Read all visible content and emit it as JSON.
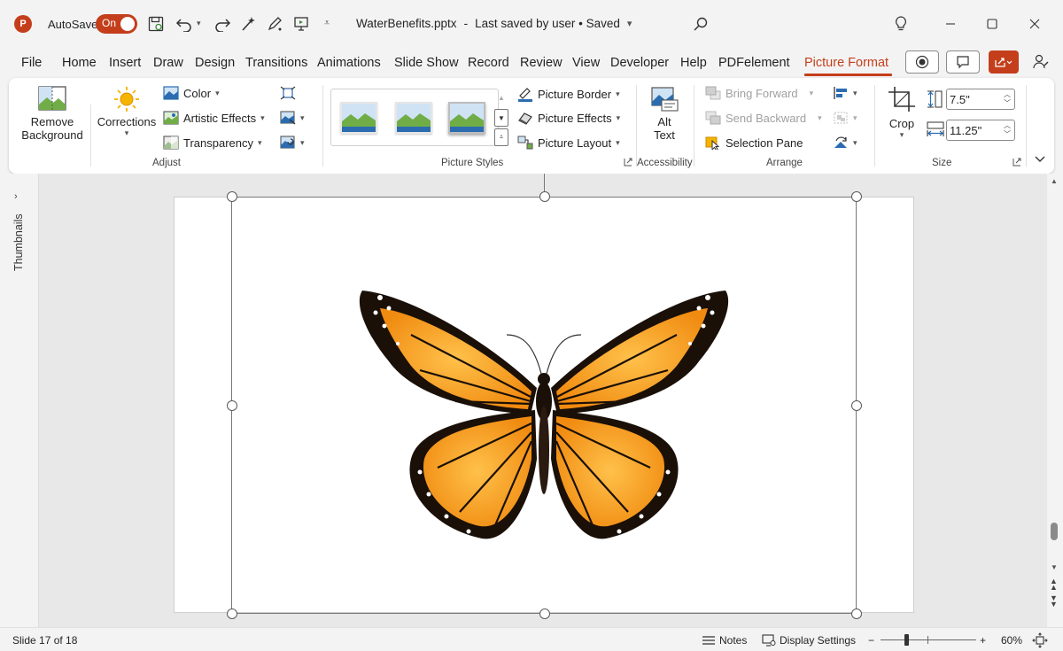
{
  "colors": {
    "accent": "#c43e1c",
    "toggle": "#c43e1c",
    "share": "#c43e1c"
  },
  "titlebar": {
    "app_icon": "powerpoint-logo",
    "autosave_label": "AutoSave",
    "autosave_state": "On",
    "filename": "WaterBenefits.pptx",
    "separator": "-",
    "save_status": "Last saved by user • Saved"
  },
  "menu": {
    "tabs": [
      "File",
      "Home",
      "Insert",
      "Draw",
      "Design",
      "Transitions",
      "Animations",
      "Slide Show",
      "Record",
      "Review",
      "View",
      "Developer",
      "Help",
      "PDFelement",
      "Picture Format"
    ],
    "active": "Picture Format"
  },
  "ribbon": {
    "adjust": {
      "remove_bg": [
        "Remove",
        "Background"
      ],
      "corrections": "Corrections",
      "color": "Color",
      "artistic": "Artistic Effects",
      "transparency": "Transparency",
      "group": "Adjust"
    },
    "styles": {
      "border": "Picture Border",
      "effects": "Picture Effects",
      "layout": "Picture Layout",
      "group": "Picture Styles"
    },
    "accessibility": {
      "alt": [
        "Alt",
        "Text"
      ],
      "group": "Accessibility"
    },
    "arrange": {
      "forward": "Bring Forward",
      "backward": "Send Backward",
      "selection": "Selection Pane",
      "group": "Arrange"
    },
    "size": {
      "crop": "Crop",
      "height": "7.5\"",
      "width": "11.25\"",
      "group": "Size"
    }
  },
  "left_panel": {
    "label": "Thumbnails"
  },
  "status": {
    "slide": "Slide 17 of 18",
    "notes": "Notes",
    "display": "Display Settings",
    "zoom_minus": "−",
    "zoom_plus": "+",
    "zoom": "60%",
    "zoom_level": 0.6
  }
}
